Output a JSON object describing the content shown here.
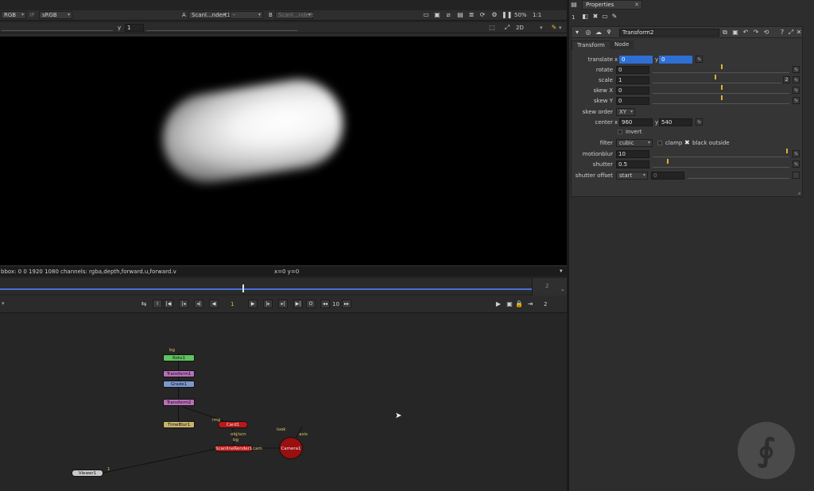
{
  "viewer": {
    "channel": "RGB",
    "ip": "IP",
    "colorspace": "sRGB",
    "a_label": "A",
    "a_input": "Scanl...ndert1",
    "a_op": "-",
    "b_label": "B",
    "b_input": "Scanl...ndert",
    "zoom": "50%",
    "ratio": "1:1",
    "y_label": "y",
    "y_value": "1",
    "view_mode": "2D",
    "info": "bbox: 0 0 1920 1080 channels: rgba,depth,forward.u,forward.v",
    "coords": "x=0 y=0"
  },
  "timeline": {
    "current_frame": "1",
    "end_frame_top": "2",
    "increment": "10",
    "end_frame": "2"
  },
  "graph": {
    "nodes": [
      {
        "label": "Roto1"
      },
      {
        "label": "Transform1"
      },
      {
        "label": "Grade1"
      },
      {
        "label": "Transform2"
      },
      {
        "label": "TimeBlur1"
      },
      {
        "label": "Card1"
      },
      {
        "label": "ScanlineRender1"
      },
      {
        "label": "Camera1"
      },
      {
        "label": "Viewer1"
      }
    ],
    "pipe_labels": {
      "bg": "bg",
      "img": "img",
      "obj_scn": "obj/scn",
      "bg2": "bg",
      "cam": "cam",
      "look": "look",
      "axis": "axis",
      "viewer_in": "1"
    }
  },
  "properties": {
    "tab_title": "Properties",
    "tab_number": "1",
    "node_name": "Transform2",
    "subtabs": [
      "Transform",
      "Node"
    ],
    "knobs": {
      "translate_label": "translate",
      "translate_x_prefix": "x",
      "translate_x": "0",
      "translate_y_prefix": "y",
      "translate_y": "0",
      "rotate_label": "rotate",
      "rotate": "0",
      "scale_label": "scale",
      "scale": "1",
      "scale_badge": "2",
      "skew_x_label": "skew X",
      "skew_x": "0",
      "skew_y_label": "skew Y",
      "skew_y": "0",
      "skew_order_label": "skew order",
      "skew_order": "XY",
      "center_label": "center",
      "center_x_prefix": "x",
      "center_x": "960",
      "center_y_prefix": "y",
      "center_y": "540",
      "invert_label": "invert",
      "filter_label": "filter",
      "filter": "cubic",
      "clamp_label": "clamp",
      "black_outside_label": "black outside",
      "motionblur_label": "motionblur",
      "motionblur": "10",
      "shutter_label": "shutter",
      "shutter": "0.5",
      "shutter_offset_label": "shutter offset",
      "shutter_offset": "start",
      "shutter_offset_value": "0"
    }
  }
}
